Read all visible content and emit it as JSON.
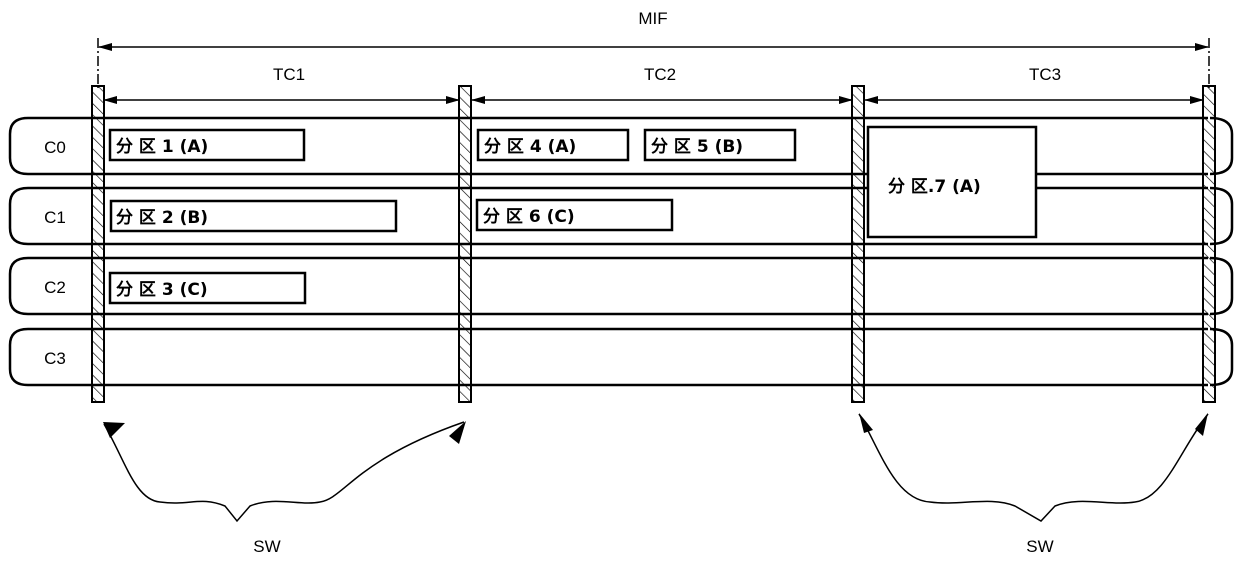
{
  "diagram": {
    "span_label": "MIF",
    "time_cycles": [
      {
        "id": "tc1",
        "label": "TC1"
      },
      {
        "id": "tc2",
        "label": "TC2"
      },
      {
        "id": "tc3",
        "label": "TC3"
      }
    ],
    "cores": [
      {
        "id": "c0",
        "label": "C0"
      },
      {
        "id": "c1",
        "label": "C1"
      },
      {
        "id": "c2",
        "label": "C2"
      },
      {
        "id": "c3",
        "label": "C3"
      }
    ],
    "partitions": [
      {
        "id": "p1",
        "label": "分 区 1 (A)",
        "core": "C0",
        "cycle": "TC1"
      },
      {
        "id": "p2",
        "label": "分 区 2 (B)",
        "core": "C1",
        "cycle": "TC1"
      },
      {
        "id": "p3",
        "label": "分 区 3 (C)",
        "core": "C2",
        "cycle": "TC1"
      },
      {
        "id": "p4",
        "label": "分 区 4 (A)",
        "core": "C0",
        "cycle": "TC2"
      },
      {
        "id": "p5",
        "label": "分 区 5 (B)",
        "core": "C0",
        "cycle": "TC2"
      },
      {
        "id": "p6",
        "label": "分 区 6 (C)",
        "core": "C1",
        "cycle": "TC2"
      },
      {
        "id": "p7",
        "label": "分 区.7 (A)",
        "core": "C0-C1",
        "cycle": "TC3"
      }
    ],
    "switch_labels": [
      "SW",
      "SW"
    ]
  }
}
